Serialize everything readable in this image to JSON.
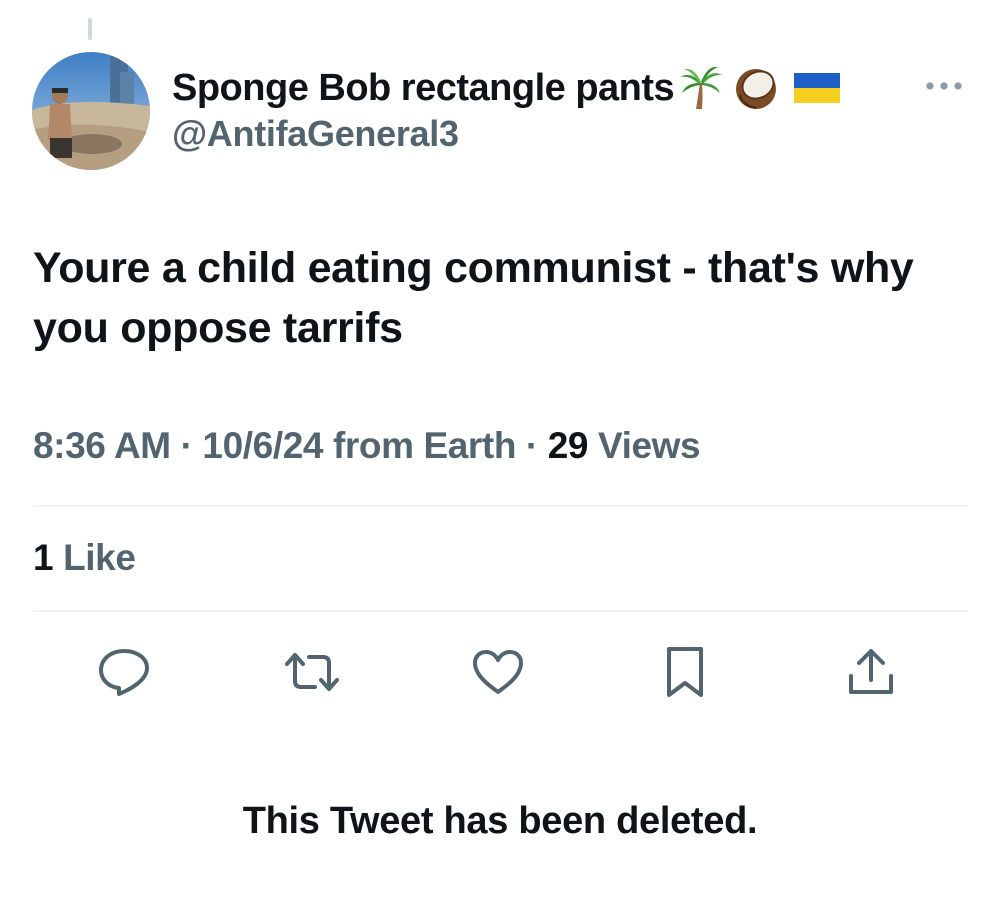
{
  "colors": {
    "primary_text": "#0f1419",
    "secondary_text": "#536471",
    "icon": "#536471",
    "divider": "#eff3f4",
    "thread_line": "#cfd9de"
  },
  "author": {
    "display_name": "Sponge Bob rectangle pants",
    "name_emojis": [
      "palm-tree-icon",
      "coconut-icon",
      "ukraine-flag-icon"
    ],
    "handle": "@AntifaGeneral3",
    "avatar": "avatar"
  },
  "tweet": {
    "text": "Youre a child eating communist - that's why you oppose tarrifs",
    "time": "8:36 AM",
    "separator": "·",
    "date": "10/6/24",
    "source": "from Earth",
    "views_count": "29",
    "views_label": "Views",
    "likes_count": "1",
    "likes_label": "Like"
  },
  "actions": [
    {
      "name": "reply-icon"
    },
    {
      "name": "retweet-icon"
    },
    {
      "name": "like-icon"
    },
    {
      "name": "bookmark-icon"
    },
    {
      "name": "share-icon"
    }
  ],
  "menu": {
    "icon": "more-options-icon"
  },
  "notice": {
    "text": "This Tweet has been deleted."
  }
}
